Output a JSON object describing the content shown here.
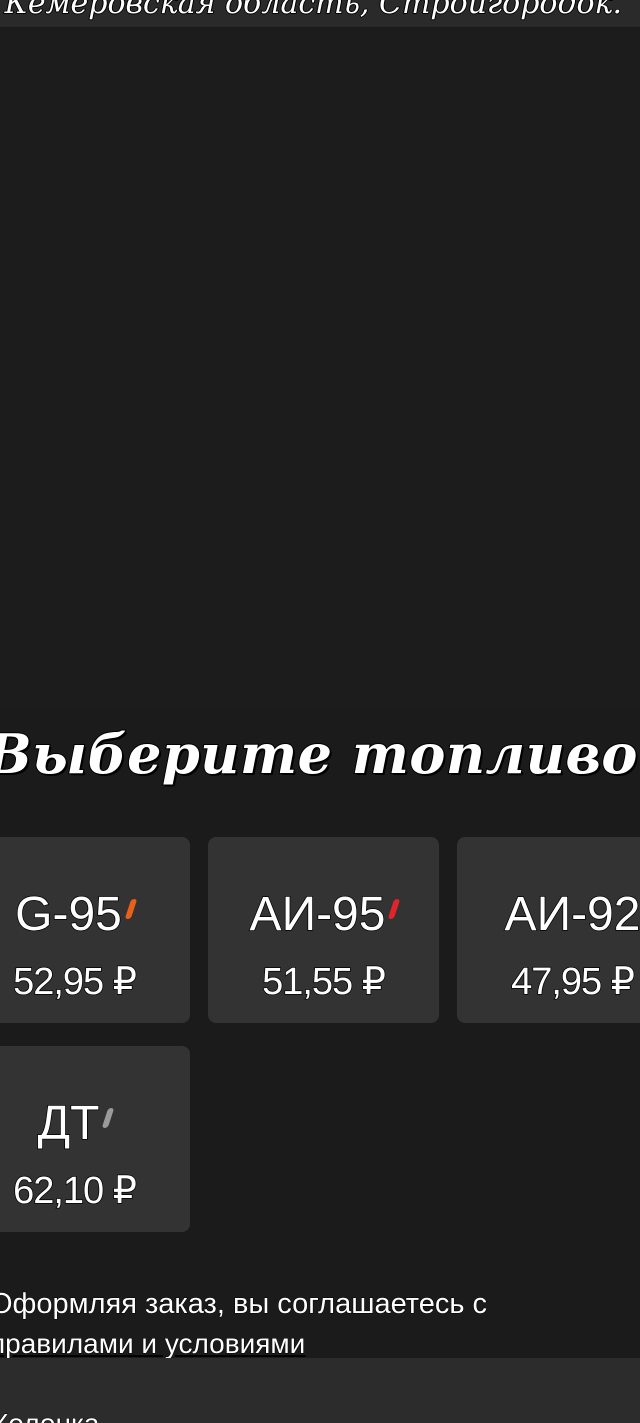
{
  "header": {
    "address": "Кемеровская область, Стройгородок."
  },
  "fuel_section": {
    "title": "Выберите топливо",
    "fuels": [
      {
        "name": "G-95",
        "price": "52,95 ₽",
        "mark_color": "#e8611a"
      },
      {
        "name": "АИ-95",
        "price": "51,55 ₽",
        "mark_color": "#e0242a"
      },
      {
        "name": "АИ-92",
        "price": "47,95 ₽",
        "mark_color": ""
      },
      {
        "name": "ДТ",
        "price": "62,10 ₽",
        "mark_color": "#9a9a9a"
      }
    ]
  },
  "consent": {
    "text": "Оформляя заказ, вы соглашаетесь с",
    "link": "правилами и условиями"
  },
  "bottom": {
    "label": "Колонка"
  },
  "colors": {
    "background": "#1b1b1b",
    "card": "#333333",
    "panel": "#2c2c2c"
  }
}
